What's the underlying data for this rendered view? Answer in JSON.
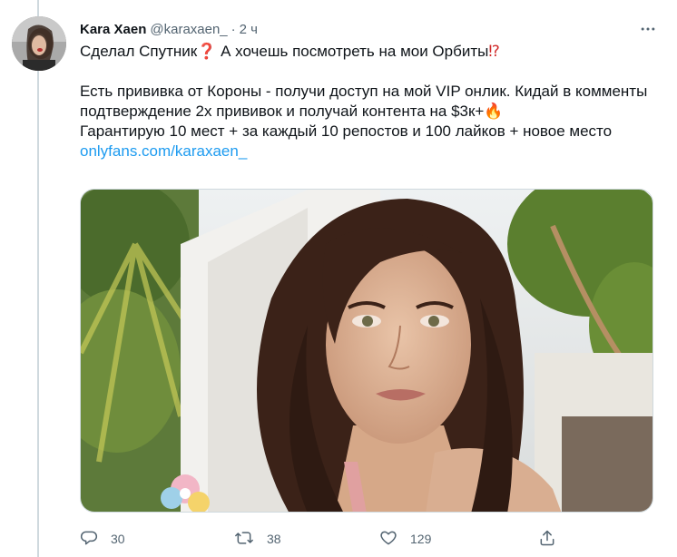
{
  "tweet": {
    "author_name": "Kara Xaen",
    "handle": "@karaxaen_",
    "separator": "·",
    "time": "2 ч",
    "line1": "Сделал Спутник",
    "line1_emoji": "❓",
    "line1_rest": " А хочешь посмотреть на мои Орбиты",
    "line1_end_emoji": "⁉",
    "para2": "Есть прививка от Короны - получи доступ на мой VIP онлик. Кидай в комменты подтверждение 2х прививок и получай контента на $3к+",
    "para2_emoji": "🔥",
    "para3": "Гарантирую 10 мест + за каждый 10 репостов и 100 лайков + новое место ",
    "link": "onlyfans.com/karaxaen_"
  },
  "actions": {
    "replies": "30",
    "retweets": "38",
    "likes": "129"
  },
  "icons": {
    "reply": "reply-icon",
    "retweet": "retweet-icon",
    "like": "heart-icon",
    "share": "share-icon",
    "more": "more-icon"
  },
  "colors": {
    "accent": "#1d9bf0",
    "muted": "#536471",
    "line": "#cfd9de"
  }
}
